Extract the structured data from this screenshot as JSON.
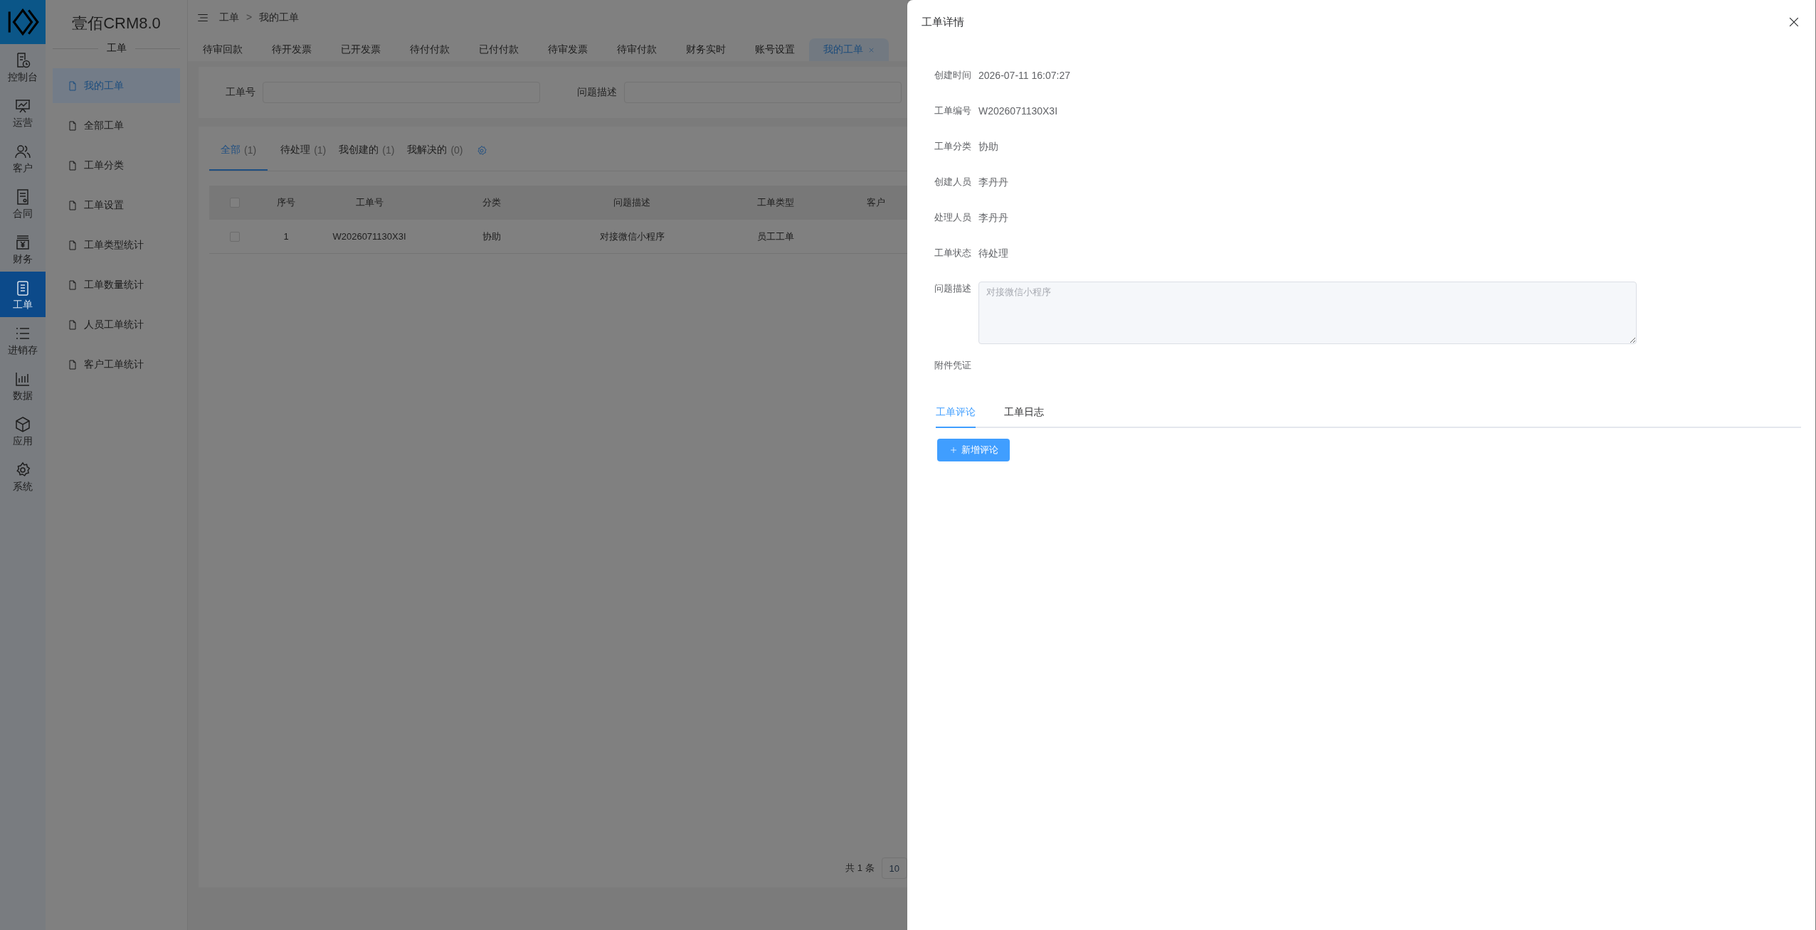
{
  "rail": [
    {
      "label": "控制台",
      "selected": false
    },
    {
      "label": "运营",
      "selected": false
    },
    {
      "label": "客户",
      "selected": false
    },
    {
      "label": "合同",
      "selected": false
    },
    {
      "label": "财务",
      "selected": false
    },
    {
      "label": "工单",
      "selected": true
    },
    {
      "label": "进销存",
      "selected": false
    },
    {
      "label": "数据",
      "selected": false
    },
    {
      "label": "应用",
      "selected": false
    },
    {
      "label": "系统",
      "selected": false
    }
  ],
  "sidebar": {
    "title": "壹佰CRM8.0",
    "section": "工单",
    "items": [
      {
        "label": "我的工单",
        "selected": true
      },
      {
        "label": "全部工单",
        "selected": false
      },
      {
        "label": "工单分类",
        "selected": false
      },
      {
        "label": "工单设置",
        "selected": false
      },
      {
        "label": "工单类型统计",
        "selected": false
      },
      {
        "label": "工单数量统计",
        "selected": false
      },
      {
        "label": "人员工单统计",
        "selected": false
      },
      {
        "label": "客户工单统计",
        "selected": false
      }
    ]
  },
  "breadcrumb": {
    "items": [
      "工单",
      "我的工单"
    ],
    "separator": ">"
  },
  "page_tabs": [
    {
      "label": "待审回款",
      "selected": false,
      "closable": false
    },
    {
      "label": "待开发票",
      "selected": false,
      "closable": false
    },
    {
      "label": "已开发票",
      "selected": false,
      "closable": false
    },
    {
      "label": "待付付款",
      "selected": false,
      "closable": false
    },
    {
      "label": "已付付款",
      "selected": false,
      "closable": false
    },
    {
      "label": "待审发票",
      "selected": false,
      "closable": false
    },
    {
      "label": "待审付款",
      "selected": false,
      "closable": false
    },
    {
      "label": "财务实时",
      "selected": false,
      "closable": false
    },
    {
      "label": "账号设置",
      "selected": false,
      "closable": false
    },
    {
      "label": "我的工单",
      "selected": true,
      "closable": true
    }
  ],
  "filters": [
    {
      "label": "工单号"
    },
    {
      "label": "问题描述"
    }
  ],
  "list_tabs": [
    {
      "label": "全部",
      "count": "(1)",
      "selected": true
    },
    {
      "label": "待处理",
      "count": "(1)",
      "selected": false
    },
    {
      "label": "我创建的",
      "count": "(1)",
      "selected": false
    },
    {
      "label": "我解决的",
      "count": "(0)",
      "selected": false
    }
  ],
  "table": {
    "header_checked": false,
    "columns": [
      "序号",
      "工单号",
      "分类",
      "问题描述",
      "工单类型",
      "客户"
    ],
    "rows": [
      {
        "checked": false,
        "cells": [
          "1",
          "W2026071130X3I",
          "协助",
          "对接微信小程序",
          "员工工单",
          ""
        ]
      }
    ]
  },
  "pagination": {
    "total": "共 1 条",
    "page_size": "10"
  },
  "drawer": {
    "title": "工单详情",
    "fields": [
      {
        "label": "创建时间",
        "value": "2026-07-11 16:07:27",
        "kind": "text"
      },
      {
        "label": "工单编号",
        "value": "W2026071130X3I",
        "kind": "text"
      },
      {
        "label": "工单分类",
        "value": "协助",
        "kind": "text"
      },
      {
        "label": "创建人员",
        "value": "李丹丹",
        "kind": "text"
      },
      {
        "label": "处理人员",
        "value": "李丹丹",
        "kind": "text"
      },
      {
        "label": "工单状态",
        "value": "待处理",
        "kind": "text"
      },
      {
        "label": "问题描述",
        "value": "对接微信小程序",
        "kind": "textarea",
        "disabled": true
      },
      {
        "label": "附件凭证",
        "kind": "attachments"
      }
    ],
    "tabs": [
      {
        "label": "工单评论",
        "selected": true
      },
      {
        "label": "工单日志",
        "selected": false
      }
    ],
    "add_button": "新增评论"
  }
}
